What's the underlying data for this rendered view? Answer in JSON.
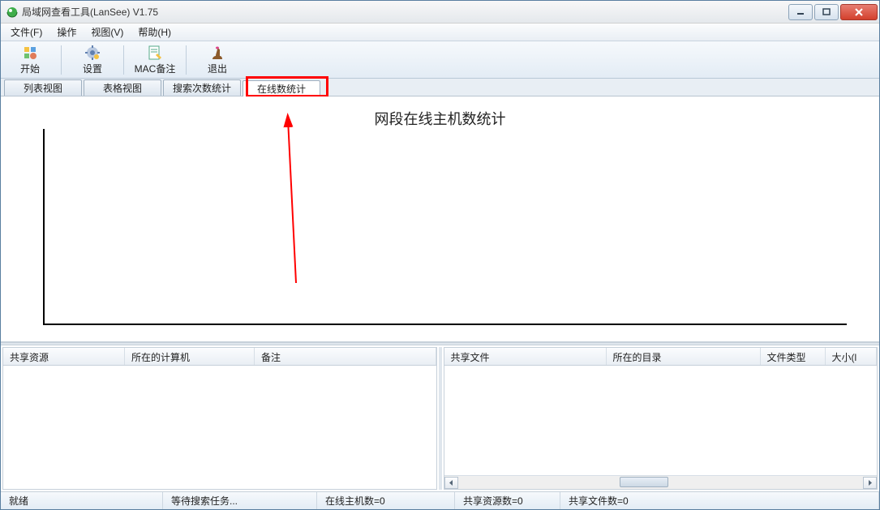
{
  "window": {
    "title": "局域网查看工具(LanSee) V1.75"
  },
  "menu": {
    "file": "文件(F)",
    "operate": "操作",
    "view": "视图(V)",
    "help": "帮助(H)"
  },
  "toolbar": {
    "start": "开始",
    "settings": "设置",
    "mac_note": "MAC备注",
    "exit": "退出"
  },
  "tabs": {
    "list_view": "列表视图",
    "table_view": "表格视图",
    "search_stats": "搜索次数统计",
    "online_stats": "在线数统计"
  },
  "chart": {
    "title": "网段在线主机数统计"
  },
  "chart_data": {
    "type": "bar",
    "title": "网段在线主机数统计",
    "categories": [],
    "values": [],
    "xlabel": "",
    "ylabel": "",
    "ylim": [
      0,
      0
    ]
  },
  "left_pane": {
    "col_resource": "共享资源",
    "col_computer": "所在的计算机",
    "col_note": "备注"
  },
  "right_pane": {
    "col_file": "共享文件",
    "col_dir": "所在的目录",
    "col_type": "文件类型",
    "col_size": "大小(l"
  },
  "status": {
    "ready": "就绪",
    "waiting": "等待搜索任务...",
    "hosts": "在线主机数=0",
    "resources": "共享资源数=0",
    "files": "共享文件数=0"
  }
}
